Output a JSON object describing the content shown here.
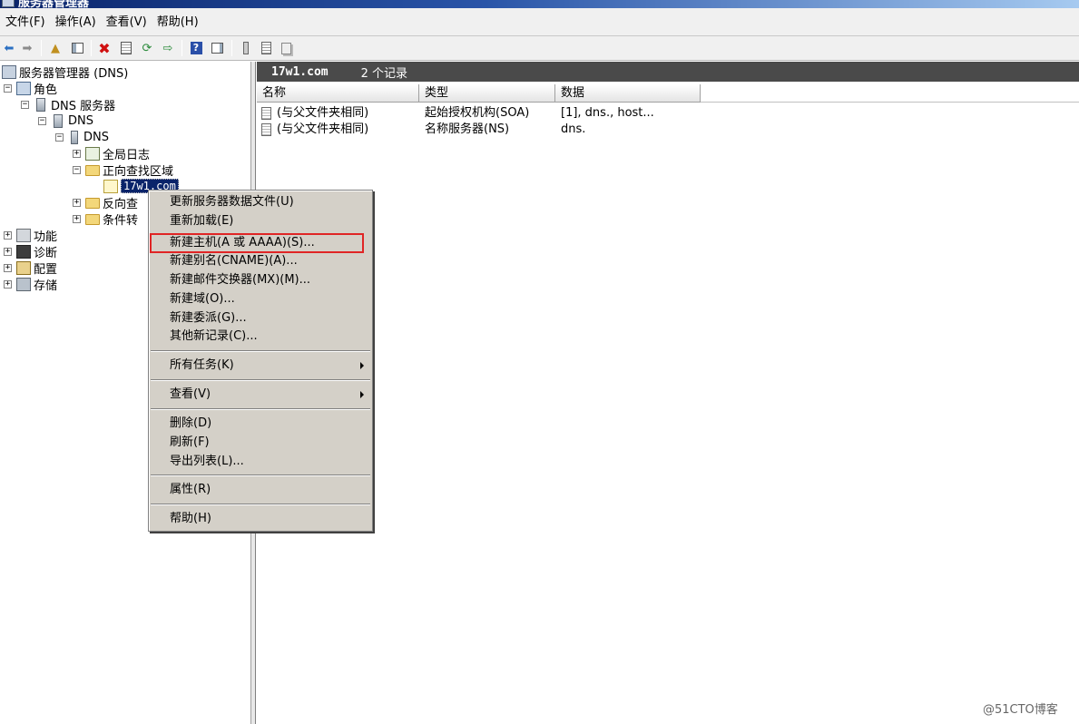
{
  "window": {
    "title": "服务器管理器"
  },
  "menubar": [
    "文件(F)",
    "操作(A)",
    "查看(V)",
    "帮助(H)"
  ],
  "toolbar": {
    "icons": [
      "back-arrow-icon",
      "forward-arrow-icon",
      "up-folder-icon",
      "show-tree-icon",
      "delete-icon",
      "properties-icon",
      "refresh-icon",
      "export-icon",
      "help-icon",
      "show-action-pane-icon",
      "server-icon",
      "list-icon",
      "copy-icon"
    ]
  },
  "tree": {
    "root": "服务器管理器 (DNS)",
    "roles": "角色",
    "dns_server": "DNS 服务器",
    "dns": "DNS",
    "dns_host": "DNS",
    "global_logs": "全局日志",
    "forward_zones": "正向查找区域",
    "zone": "17w1.com",
    "reverse_zones": "反向查",
    "conditional_fwd": "条件转",
    "features": "功能",
    "diagnostics": "诊断",
    "configuration": "配置",
    "storage": "存储",
    "expand_plus": "+",
    "expand_minus": "−"
  },
  "right_header": {
    "zone": "17w1.com",
    "count": "2 个记录"
  },
  "columns": [
    "名称",
    "类型",
    "数据"
  ],
  "records": [
    {
      "name": "(与父文件夹相同)",
      "type": "起始授权机构(SOA)",
      "data": "[1], dns., host..."
    },
    {
      "name": "(与父文件夹相同)",
      "type": "名称服务器(NS)",
      "data": "dns."
    }
  ],
  "context_menu": {
    "update_server_file": "更新服务器数据文件(U)",
    "reload": "重新加载(E)",
    "new_host": "新建主机(A 或 AAAA)(S)...",
    "new_alias": "新建别名(CNAME)(A)...",
    "new_mx": "新建邮件交换器(MX)(M)...",
    "new_domain": "新建域(O)...",
    "new_delegation": "新建委派(G)...",
    "other_records": "其他新记录(C)...",
    "all_tasks": "所有任务(K)",
    "view": "查看(V)",
    "delete": "删除(D)",
    "refresh": "刷新(F)",
    "export_list": "导出列表(L)...",
    "properties": "属性(R)",
    "help": "帮助(H)"
  },
  "watermark": "@51CTO博客",
  "colors": {
    "highlight_box": "#e02525",
    "selection": "#0a246a",
    "header_bg": "#4a4a4a"
  }
}
